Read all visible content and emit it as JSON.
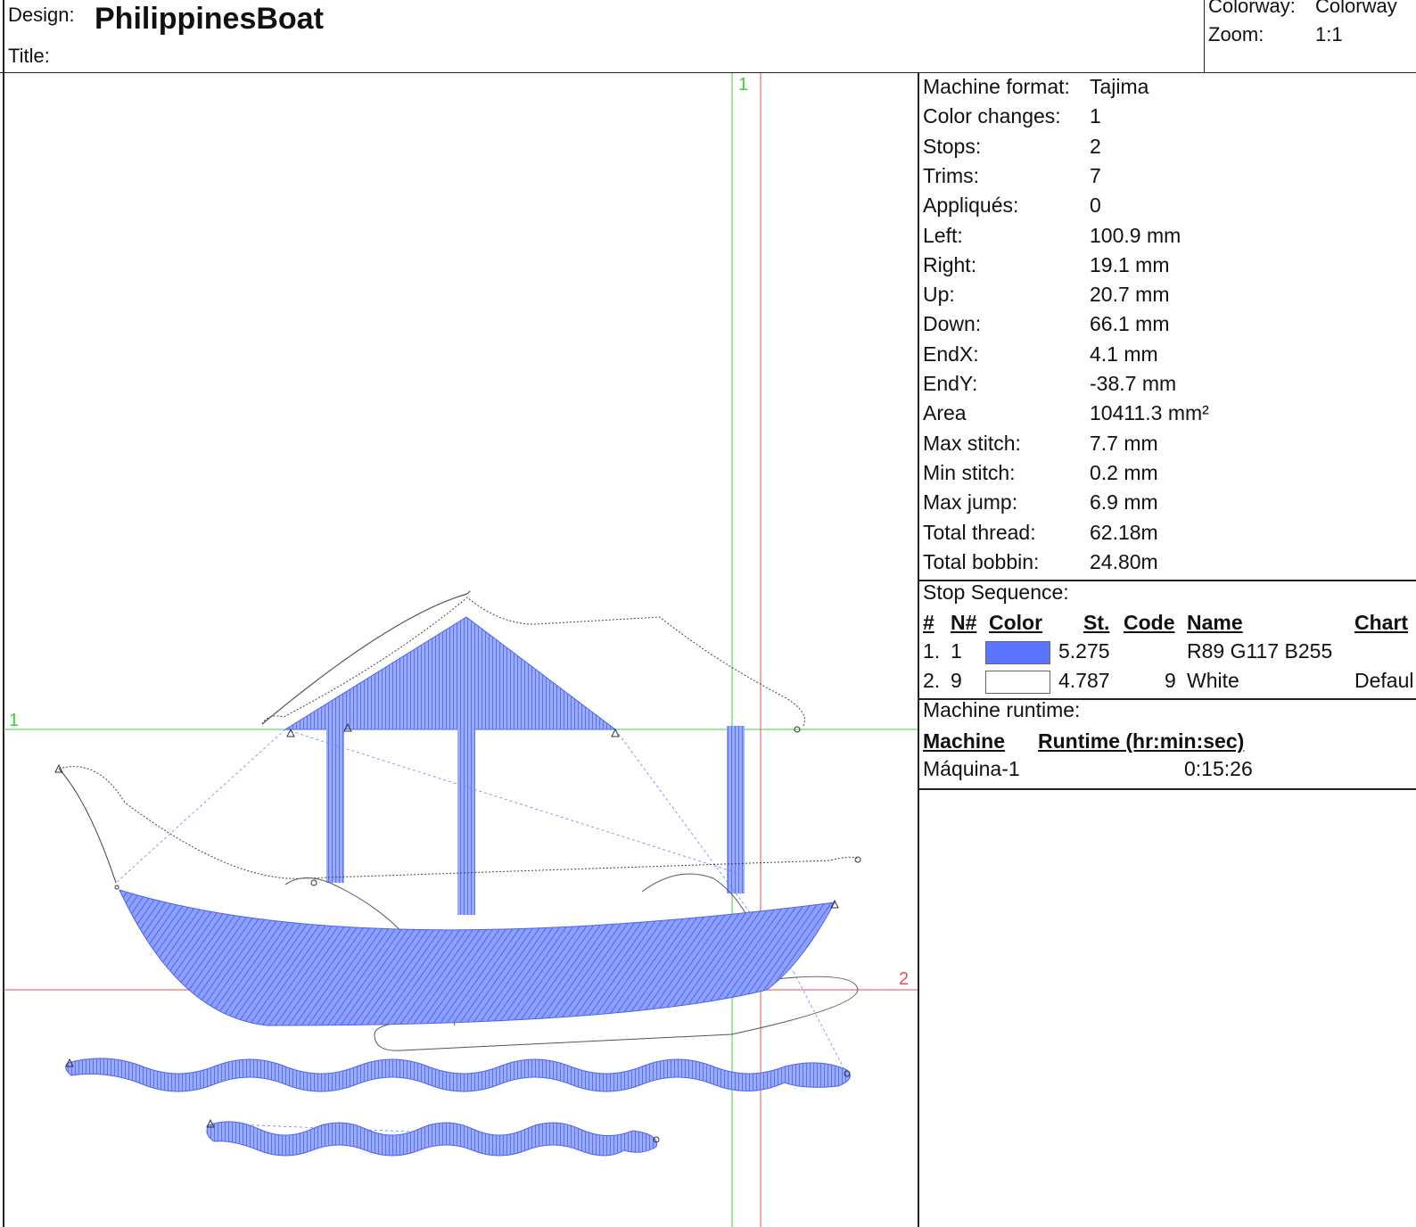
{
  "header": {
    "design_label": "Design:",
    "design_name": "PhilippinesBoat",
    "title_label": "Title:",
    "colorway_label": "Colorway:",
    "colorway_value": "Colorway",
    "zoom_label": "Zoom:",
    "zoom_value": "1:1"
  },
  "stats": [
    {
      "label": "Machine format:",
      "value": "Tajima"
    },
    {
      "label": "Color changes:",
      "value": "1"
    },
    {
      "label": "Stops:",
      "value": "2"
    },
    {
      "label": "Trims:",
      "value": "7"
    },
    {
      "label": "Appliqués:",
      "value": "0"
    },
    {
      "label": "Left:",
      "value": "100.9 mm"
    },
    {
      "label": "Right:",
      "value": "19.1 mm"
    },
    {
      "label": "Up:",
      "value": "20.7 mm"
    },
    {
      "label": "Down:",
      "value": "66.1 mm"
    },
    {
      "label": "EndX:",
      "value": "4.1 mm"
    },
    {
      "label": "EndY:",
      "value": "-38.7 mm"
    },
    {
      "label": "Area",
      "value": "10411.3 mm²"
    },
    {
      "label": "Max stitch:",
      "value": "7.7 mm"
    },
    {
      "label": "Min stitch:",
      "value": "0.2 mm"
    },
    {
      "label": "Max jump:",
      "value": "6.9 mm"
    },
    {
      "label": "Total thread:",
      "value": "62.18m"
    },
    {
      "label": "Total bobbin:",
      "value": "24.80m"
    }
  ],
  "stop_sequence": {
    "title": "Stop Sequence:",
    "headers": {
      "num": "#",
      "needle": "N#",
      "color": "Color",
      "stitches": "St.",
      "code": "Code",
      "name": "Name",
      "chart": "Chart"
    },
    "rows": [
      {
        "num": "1.",
        "needle": "1",
        "color": "#5b75ff",
        "stitches": "5.275",
        "code": "",
        "name": "R89 G117 B255",
        "chart": ""
      },
      {
        "num": "2.",
        "needle": "9",
        "color": "#ffffff",
        "stitches": "4.787",
        "code": "9",
        "name": "White",
        "chart": "Defaul"
      }
    ]
  },
  "runtime": {
    "title": "Machine runtime:",
    "headers": {
      "machine": "Machine",
      "runtime": "Runtime (hr:min:sec)"
    },
    "rows": [
      {
        "machine": "Máquina-1",
        "runtime": "0:15:26"
      }
    ]
  },
  "canvas": {
    "guide_green_label_top": "1",
    "guide_green_label_left": "1",
    "guide_red_label_right": "2",
    "stitch_color": "#5b75ff",
    "guide_green": "#3fd13f",
    "guide_red": "#e65050"
  }
}
